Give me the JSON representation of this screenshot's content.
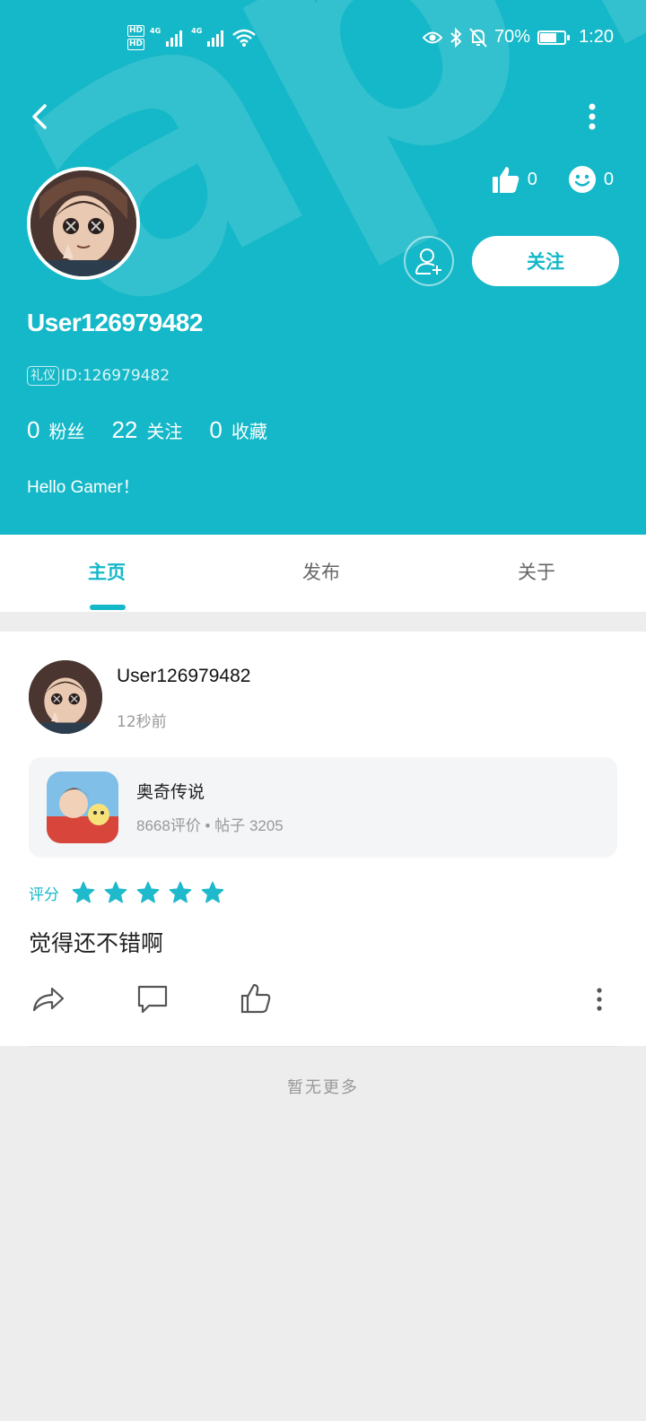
{
  "status_bar": {
    "hd1": "HD",
    "hd2": "HD",
    "sig1": "4G",
    "sig2": "4G",
    "battery_percent": "70%",
    "battery_level": 0.7,
    "time": "1:20"
  },
  "header": {
    "background_color": "#15b8c8",
    "likes": "0",
    "smiles": "0",
    "follow_label": "关注",
    "username": "User126979482",
    "badge": "礼仪",
    "id_text": "ID:126979482",
    "stats": [
      {
        "num": "0",
        "label": "粉丝"
      },
      {
        "num": "22",
        "label": "关注"
      },
      {
        "num": "0",
        "label": "收藏"
      }
    ],
    "bio": "Hello Gamer！"
  },
  "tabs": [
    {
      "label": "主页",
      "active": true
    },
    {
      "label": "发布",
      "active": false
    },
    {
      "label": "关于",
      "active": false
    }
  ],
  "post": {
    "author": "User126979482",
    "time": "12秒前",
    "game": {
      "title": "奥奇传说",
      "meta": "8668评价 • 帖子 3205"
    },
    "rating_label": "评分",
    "rating_stars": 5,
    "text": "觉得还不错啊"
  },
  "footer": {
    "no_more": "暂无更多"
  },
  "icons": [
    "back-icon",
    "more-vertical-icon",
    "thumbs-up-icon",
    "smile-icon",
    "add-friend-icon",
    "star-icon",
    "share-icon",
    "comment-icon",
    "like-icon"
  ]
}
